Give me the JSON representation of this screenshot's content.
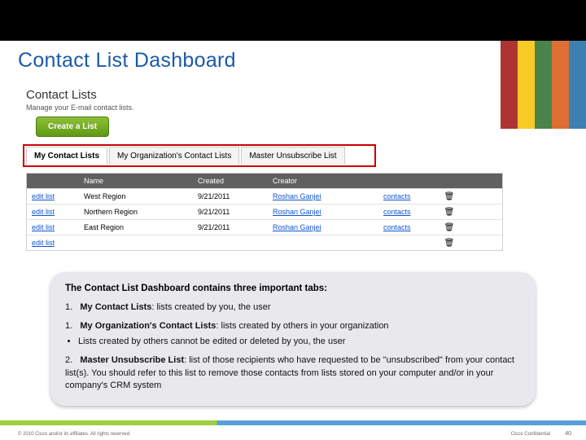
{
  "slide": {
    "title": "Contact List Dashboard"
  },
  "shot": {
    "heading": "Contact Lists",
    "subtitle": "Manage your E-mail contact lists.",
    "create_button": "Create a List"
  },
  "tabs": {
    "active": "My Contact Lists",
    "t1": "My Contact Lists",
    "t2": "My Organization's Contact Lists",
    "t3": "Master Unsubscribe List"
  },
  "grid": {
    "head": {
      "c1": "Name",
      "c2": "Created",
      "c3": "Creator"
    },
    "rows": [
      {
        "edit": "edit list",
        "name": "West Region",
        "created": "9/21/2011",
        "creator": "Roshan Ganjei",
        "contacts": "contacts"
      },
      {
        "edit": "edit list",
        "name": "Northern Region",
        "created": "9/21/2011",
        "creator": "Roshan Ganjei",
        "contacts": "contacts"
      },
      {
        "edit": "edit list",
        "name": "East Region",
        "created": "9/21/2011",
        "creator": "Roshan Ganjei",
        "contacts": "contacts"
      },
      {
        "edit": "edit list",
        "name": "",
        "created": "",
        "creator": "",
        "contacts": ""
      }
    ]
  },
  "callout": {
    "title": "The Contact List Dashboard contains three important tabs:",
    "items": [
      {
        "num": "1.",
        "bold": "My Contact Lists",
        "rest": ": lists created by you, the user"
      },
      {
        "num": "1.",
        "bold": "My Organization's Contact Lists",
        "rest": ": lists created by others in your organization",
        "sub": "Lists created by others cannot be edited or deleted by you, the user"
      },
      {
        "num": "2.",
        "bold": "Master Unsubscribe List",
        "rest": ": list of those recipients who have requested to be \"unsubscribed\" from your contact list(s). You should refer to this list to remove those contacts from lists stored on your computer and/or in your company's CRM system"
      }
    ]
  },
  "footer": {
    "copyright": "© 2010 Cisco and/or its affiliates. All rights reserved.",
    "confidential": "Cisco Confidential",
    "page": "40"
  },
  "icons": {
    "trash": "🗑"
  }
}
